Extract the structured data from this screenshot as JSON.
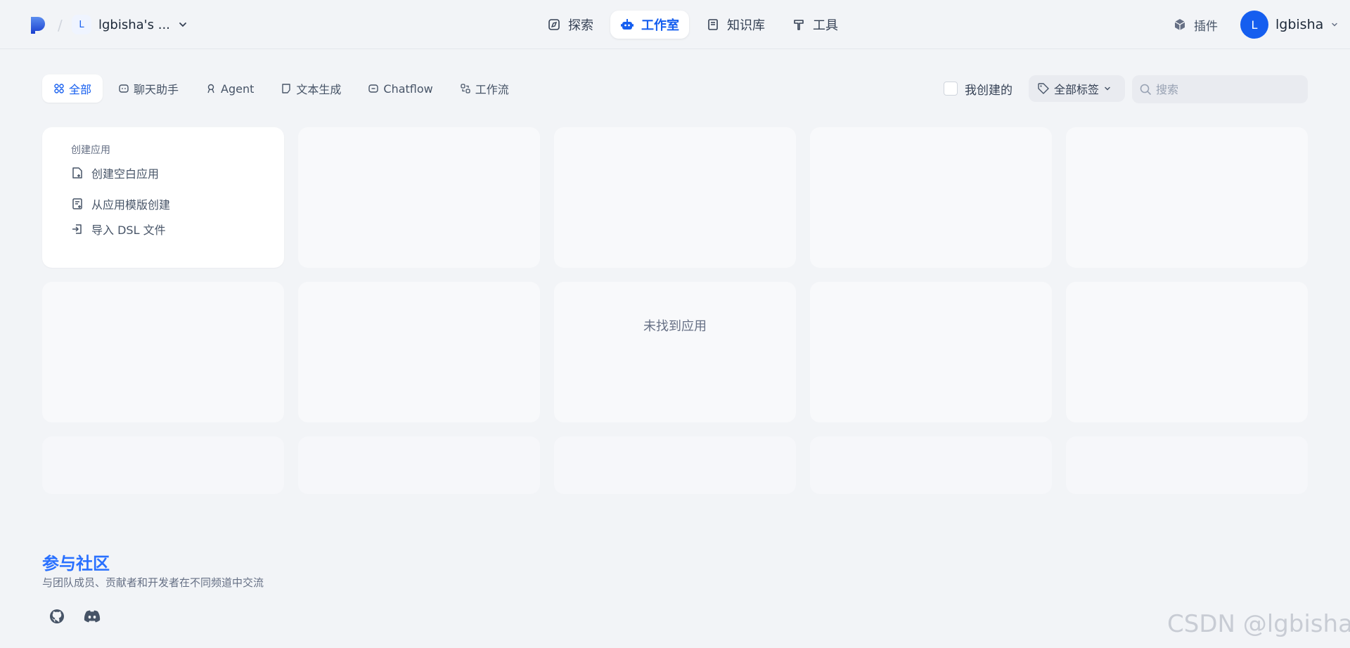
{
  "header": {
    "workspace_initial": "L",
    "workspace_name": "lgbisha's ...",
    "nav": [
      {
        "label": "探索",
        "icon": "explore-icon"
      },
      {
        "label": "工作室",
        "icon": "robot-icon"
      },
      {
        "label": "知识库",
        "icon": "book-icon"
      },
      {
        "label": "工具",
        "icon": "hammer-icon"
      }
    ],
    "active_nav": "工作室",
    "plugin_label": "插件",
    "user_initial": "L",
    "user_name": "lgbisha"
  },
  "filters": {
    "tabs": [
      {
        "label": "全部",
        "icon": "grid-icon"
      },
      {
        "label": "聊天助手",
        "icon": "chat-icon"
      },
      {
        "label": "Agent",
        "icon": "agent-icon"
      },
      {
        "label": "文本生成",
        "icon": "doc-icon"
      },
      {
        "label": "Chatflow",
        "icon": "chatflow-icon"
      },
      {
        "label": "工作流",
        "icon": "workflow-icon"
      }
    ],
    "active_tab": "全部",
    "mine_label": "我创建的",
    "tags_label": "全部标签",
    "search_placeholder": "搜索"
  },
  "create": {
    "title": "创建应用",
    "items": [
      {
        "label": "创建空白应用",
        "icon": "file-plus-icon"
      },
      {
        "label": "从应用模版创建",
        "icon": "template-icon"
      },
      {
        "label": "导入 DSL 文件",
        "icon": "import-icon"
      }
    ]
  },
  "empty_message": "未找到应用",
  "footer": {
    "title": "参与社区",
    "description": "与团队成员、贡献者和开发者在不同频道中交流"
  },
  "watermark": "CSDN @lgbisha",
  "colors": {
    "accent": "#155eef",
    "community": "#2970ff",
    "background": "#f2f4f7"
  }
}
